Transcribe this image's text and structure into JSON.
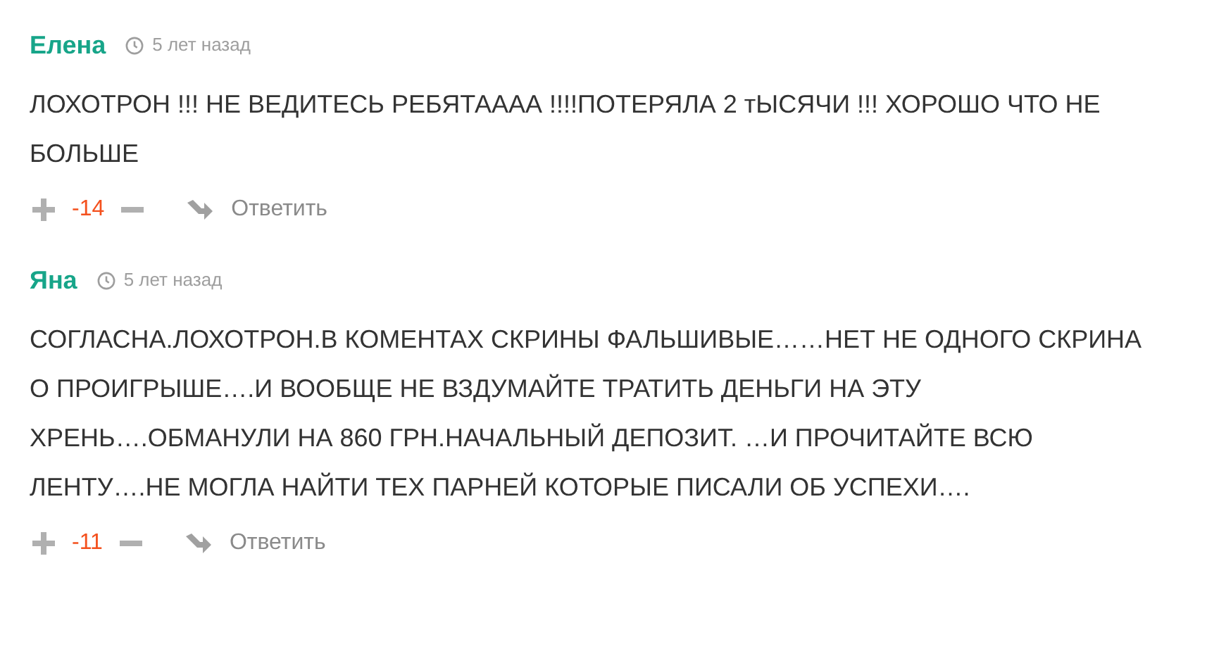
{
  "comments": [
    {
      "author": "Елена",
      "time": "5 лет назад",
      "text": "ЛОХОТРОН !!! НЕ ВЕДИТЕСЬ РЕБЯТАААА !!!!ПОТЕРЯЛА 2 тЫСЯЧИ !!! ХОРОШО ЧТО НЕ БОЛЬШЕ",
      "score": "-14",
      "reply": "Ответить"
    },
    {
      "author": "Яна",
      "time": "5 лет назад",
      "text": "СОГЛАСНА.ЛОХОТРОН.В КОМЕНТАХ СКРИНЫ ФАЛЬШИВЫЕ……НЕТ НЕ ОДНОГО СКРИНА О ПРОИГРЫШЕ….И ВООБЩЕ НЕ ВЗДУМАЙТЕ ТРАТИТЬ ДЕНЬГИ НА ЭТУ ХРЕНЬ….ОБМАНУЛИ НА 860 ГРН.НАЧАЛЬНЫЙ ДЕПОЗИТ. …И ПРОЧИТАЙТЕ ВСЮ ЛЕНТУ….НЕ МОГЛА НАЙТИ ТЕХ ПАРНЕЙ КОТОРЫЕ ПИСАЛИ ОБ УСПЕХИ….",
      "score": "-11",
      "reply": "Ответить"
    }
  ]
}
